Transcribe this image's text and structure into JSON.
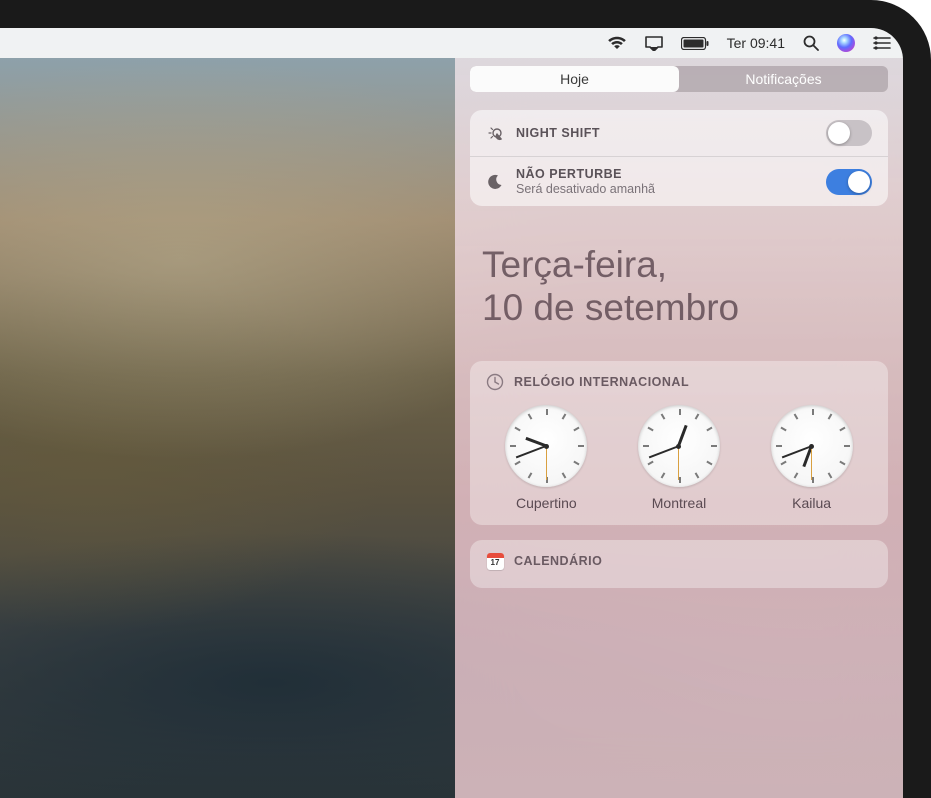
{
  "menubar": {
    "datetime": "Ter 09:41"
  },
  "nc": {
    "tabs": {
      "today": "Hoje",
      "notifications": "Notificações"
    },
    "night_shift": {
      "title": "NIGHT SHIFT",
      "enabled": false
    },
    "dnd": {
      "title": "NÃO PERTURBE",
      "subtitle": "Será desativado amanhã",
      "enabled": true
    },
    "date": {
      "line1": "Terça-feira,",
      "line2": "10 de setembro"
    },
    "world_clock": {
      "title": "RELÓGIO INTERNACIONAL",
      "clocks": [
        {
          "city": "Cupertino",
          "hour": 9,
          "minute": 41,
          "second": 30
        },
        {
          "city": "Montreal",
          "hour": 12,
          "minute": 41,
          "second": 30
        },
        {
          "city": "Kailua",
          "hour": 6,
          "minute": 41,
          "second": 30
        }
      ]
    },
    "calendar": {
      "title": "CALENDÁRIO"
    }
  }
}
